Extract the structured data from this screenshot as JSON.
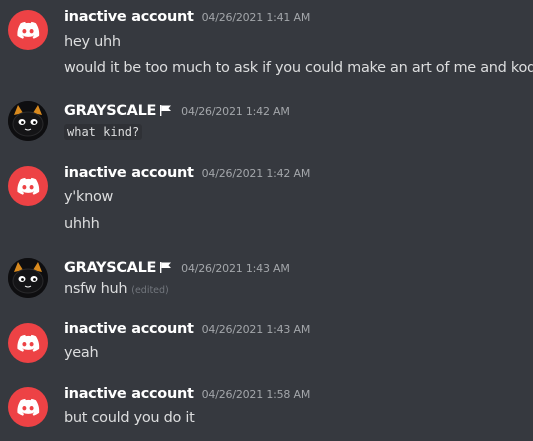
{
  "messages": [
    {
      "author": "inactive account",
      "timestamp": "04/26/2021 1:41 AM",
      "lines": [
        "hey uhh",
        "would it be too much to ask if you could make an art of me and kodo?"
      ]
    },
    {
      "author": "GRAYSCALE",
      "timestamp": "04/26/2021 1:42 AM",
      "lines": [
        "what kind?"
      ]
    },
    {
      "author": "inactive account",
      "timestamp": "04/26/2021 1:42 AM",
      "lines": [
        "y'know",
        "uhhh"
      ]
    },
    {
      "author": "GRAYSCALE",
      "timestamp": "04/26/2021 1:43 AM",
      "lines": [
        "nsfw huh"
      ],
      "edited_label": "(edited)"
    },
    {
      "author": "inactive account",
      "timestamp": "04/26/2021 1:43 AM",
      "lines": [
        "yeah"
      ]
    },
    {
      "author": "inactive account",
      "timestamp": "04/26/2021 1:58 AM",
      "lines": [
        "but could you do it"
      ]
    }
  ],
  "colors": {
    "background": "#36393f",
    "discord_red": "#ed4245",
    "username": "#ffffff",
    "message_text": "#dcddde",
    "timestamp": "#a3a6aa"
  },
  "icons": {
    "default_avatar": "discord-logo-icon",
    "grayscale_avatar": "black-cat-avatar",
    "username_badge": "flag-icon"
  }
}
